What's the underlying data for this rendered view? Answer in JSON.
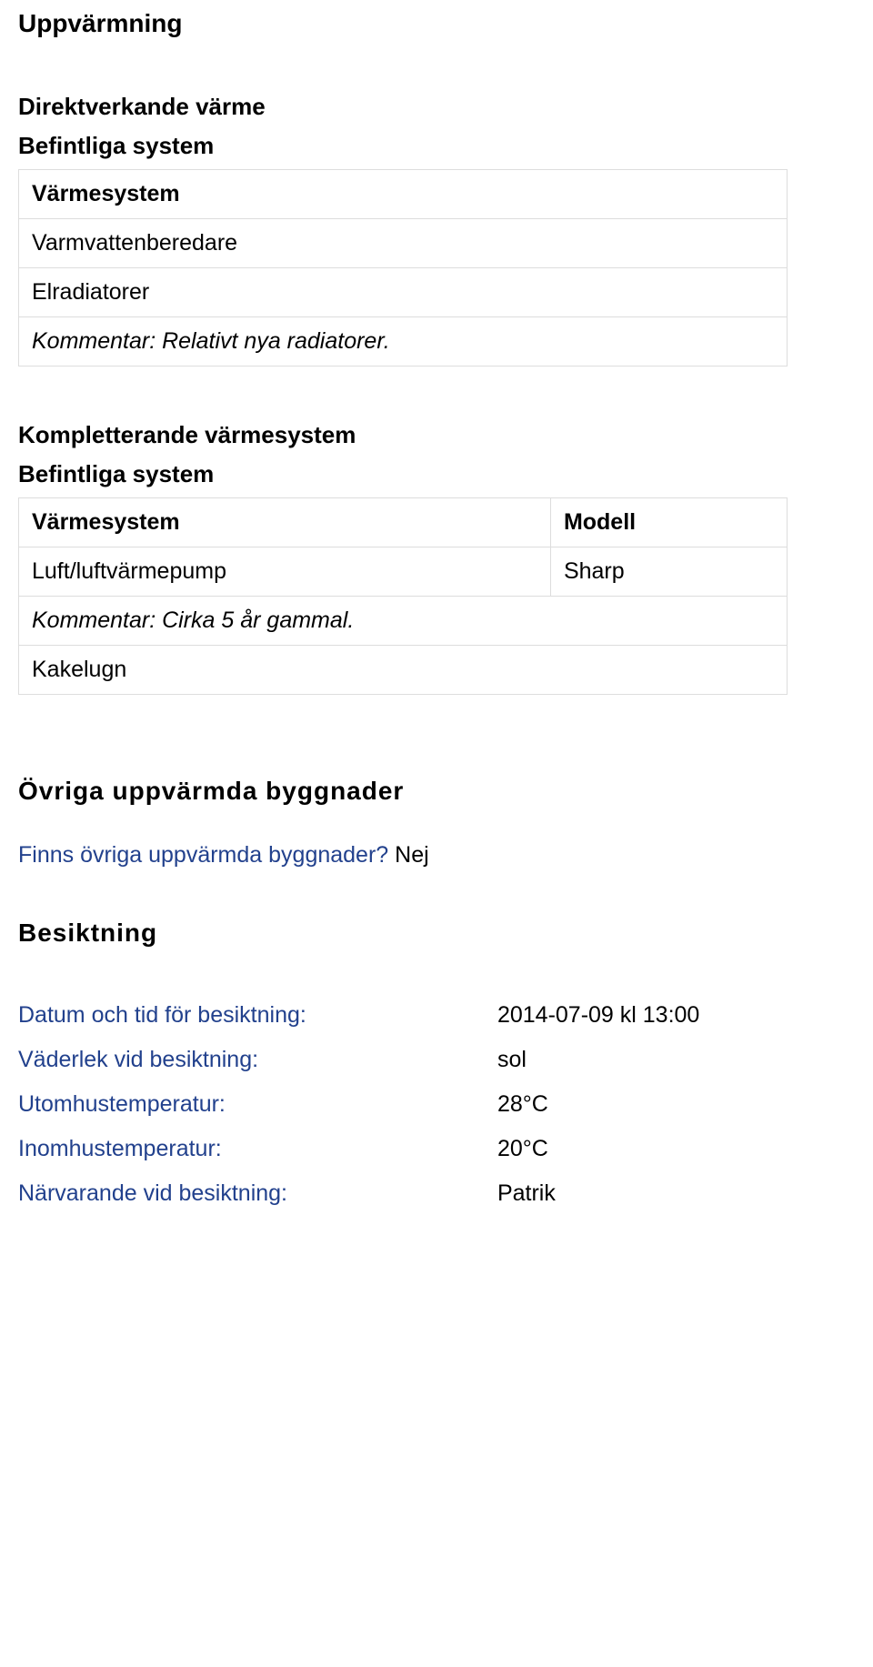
{
  "heating": {
    "title": "Uppvärmning",
    "direct": {
      "title": "Direktverkande värme",
      "subtitle": "Befintliga system",
      "system_header": "Värmesystem",
      "rows": [
        {
          "name": "Varmvattenberedare"
        },
        {
          "name": "Elradiatorer"
        }
      ],
      "comment": "Kommentar: Relativt nya radiatorer."
    },
    "supplementary": {
      "title": "Kompletterande värmesystem",
      "subtitle": "Befintliga system",
      "system_header": "Värmesystem",
      "model_header": "Modell",
      "rows": [
        {
          "name": "Luft/luftvärmepump",
          "model": "Sharp"
        }
      ],
      "comment": "Kommentar: Cirka 5 år gammal.",
      "extra_row": "Kakelugn"
    }
  },
  "other_buildings": {
    "title": "Övriga uppvärmda byggnader",
    "question": "Finns övriga uppvärmda byggnader?",
    "answer": "Nej"
  },
  "inspection": {
    "title": "Besiktning",
    "items": [
      {
        "label": "Datum och tid för besiktning:",
        "value": "2014-07-09 kl 13:00"
      },
      {
        "label": "Väderlek vid besiktning:",
        "value": "sol"
      },
      {
        "label": "Utomhustemperatur:",
        "value": "28°C"
      },
      {
        "label": "Inomhustemperatur:",
        "value": "20°C"
      },
      {
        "label": "Närvarande vid besiktning:",
        "value": "Patrik"
      }
    ]
  }
}
